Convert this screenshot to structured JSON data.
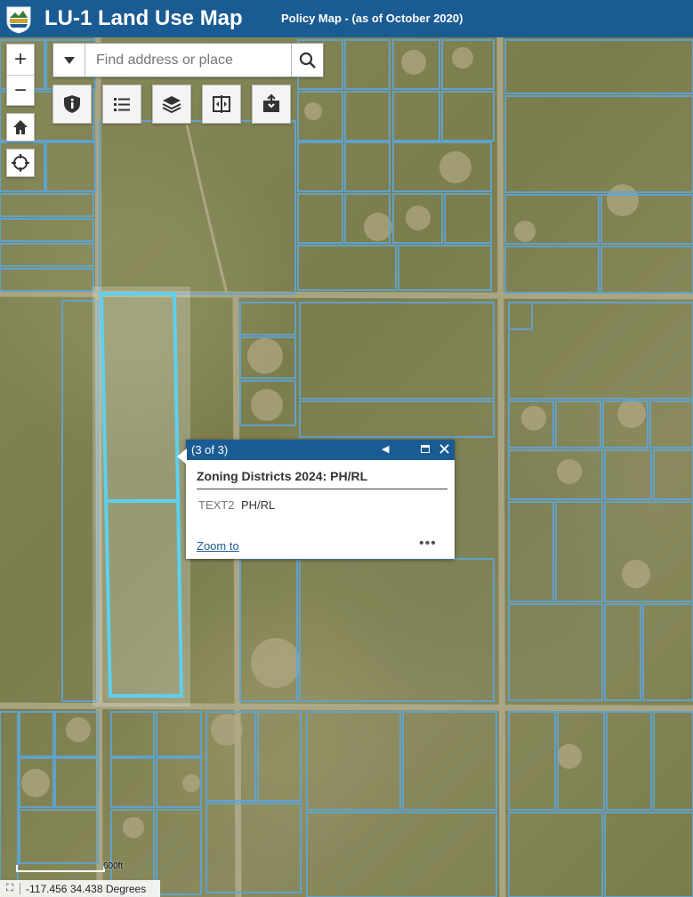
{
  "header": {
    "title": "LU-1 Land Use Map",
    "subtitle": "Policy Map - (as of October 2020)"
  },
  "controls": {
    "zoom_in": "+",
    "zoom_out": "−",
    "search_placeholder": "Find address or place"
  },
  "popup": {
    "count": "(3 of 3)",
    "title": "Zoning Districts 2024: PH/RL",
    "field_name": "TEXT2",
    "field_value": "PH/RL",
    "zoom_link": "Zoom to",
    "more": "•••"
  },
  "scale": {
    "label": "600ft"
  },
  "coordinates": {
    "text": "-117.456 34.438 Degrees"
  },
  "colors": {
    "header": "#1b5b94",
    "parcel_lines": "#5ea5d6",
    "selection": "#5ed0ee"
  }
}
